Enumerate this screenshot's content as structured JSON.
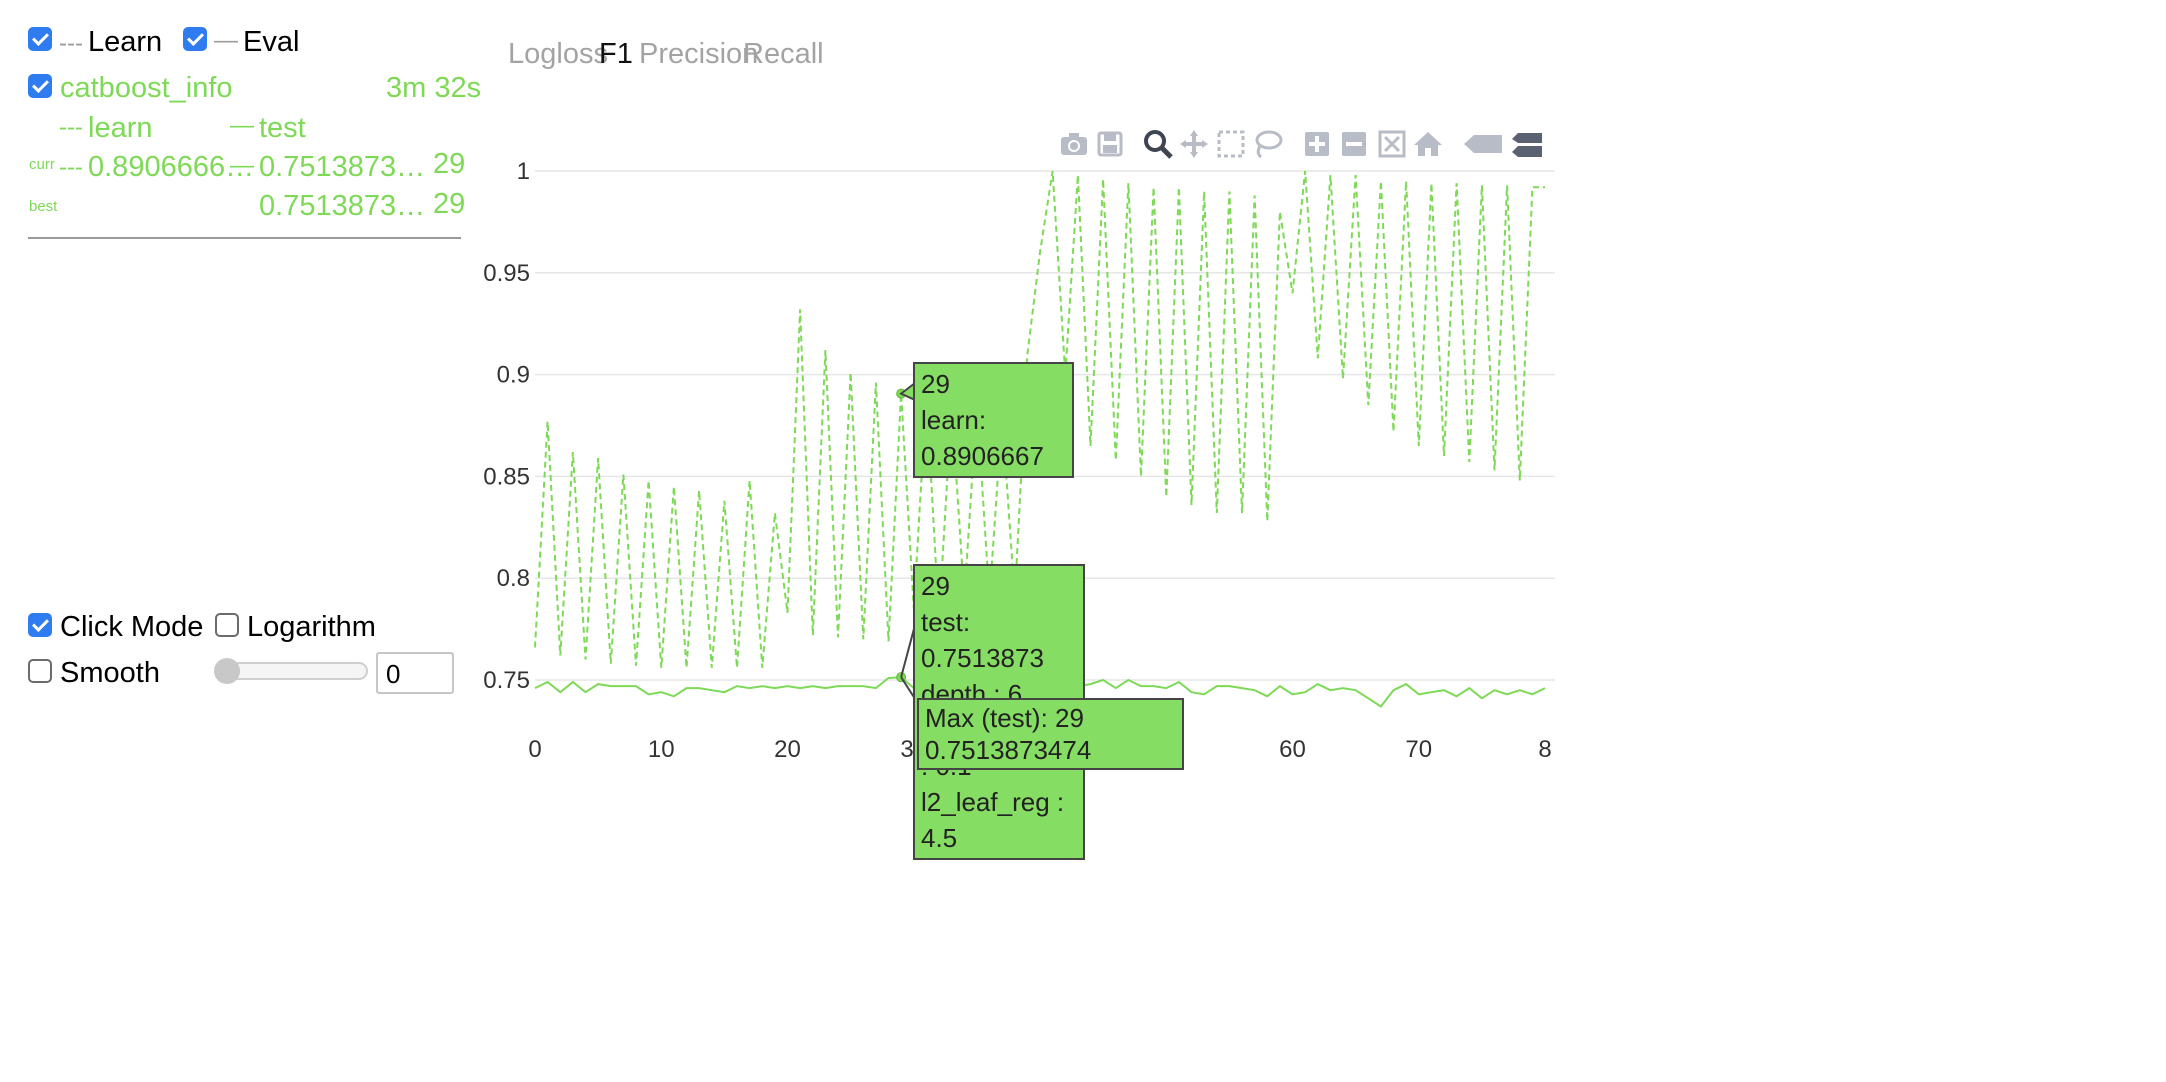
{
  "legend": {
    "learn": {
      "label": "Learn",
      "checked": true
    },
    "eval": {
      "label": "Eval",
      "checked": true
    }
  },
  "run": {
    "name": "catboost_info",
    "duration": "3m 32s",
    "col_learn": "learn",
    "col_test": "test",
    "curr_label": "curr",
    "curr_learn": "0.8906666…",
    "curr_test": "0.7513873…",
    "curr_iter": "29",
    "best_label": "best",
    "best_test": "0.7513873…",
    "best_iter": "29"
  },
  "metrics": [
    {
      "label": "Logloss",
      "active": false
    },
    {
      "label": "F1",
      "active": true
    },
    {
      "label": "Precision",
      "active": false
    },
    {
      "label": "Recall",
      "active": false
    }
  ],
  "controls": {
    "click_mode": {
      "label": "Click Mode",
      "checked": true
    },
    "logarithm": {
      "label": "Logarithm",
      "checked": false
    },
    "smooth": {
      "label": "Smooth",
      "checked": false
    },
    "smooth_value": "0"
  },
  "toolbar": [
    {
      "name": "camera-icon"
    },
    {
      "name": "save-icon"
    },
    {
      "name": "zoom-icon"
    },
    {
      "name": "pan-icon"
    },
    {
      "name": "box-select-icon"
    },
    {
      "name": "lasso-icon"
    },
    {
      "name": "zoom-in-icon"
    },
    {
      "name": "zoom-out-icon"
    },
    {
      "name": "autoscale-icon"
    },
    {
      "name": "home-icon"
    },
    {
      "name": "spike-lines-icon"
    },
    {
      "name": "compare-hover-icon"
    }
  ],
  "tooltips": {
    "learn": {
      "lines": [
        "29",
        "learn: 0.8906667"
      ]
    },
    "test": {
      "lines": [
        "29",
        "test: 0.7513873",
        "depth : 6",
        "learning_rate : 0.1",
        "l2_leaf_reg : 4.5"
      ]
    },
    "max": {
      "text": "Max (test): 29 0.7513873474"
    }
  },
  "colors": {
    "series": "#7ed957",
    "tooltip": "#86dd63",
    "checkbox": "#2f7bf0"
  },
  "chart_data": {
    "type": "line",
    "title": "",
    "xlabel": "",
    "ylabel": "",
    "xlim": [
      0,
      80
    ],
    "ylim": [
      0.735,
      1.0
    ],
    "x_ticks": [
      "0",
      "10",
      "20",
      "30",
      "40",
      "50",
      "60",
      "70",
      "8"
    ],
    "y_ticks": [
      "0.75",
      "0.8",
      "0.85",
      "0.9",
      "0.95",
      "1"
    ],
    "grid": true,
    "series": [
      {
        "name": "learn",
        "style": "dashed",
        "x": [
          0,
          1,
          2,
          3,
          4,
          5,
          6,
          7,
          8,
          9,
          10,
          11,
          12,
          13,
          14,
          15,
          16,
          17,
          18,
          19,
          20,
          21,
          22,
          23,
          24,
          25,
          26,
          27,
          28,
          29,
          30,
          31,
          32,
          33,
          34,
          35,
          36,
          37,
          38,
          39,
          40,
          41,
          42,
          43,
          44,
          45,
          46,
          47,
          48,
          49,
          50,
          51,
          52,
          53,
          54,
          55,
          56,
          57,
          58,
          59,
          60,
          61,
          62,
          63,
          64,
          65,
          66,
          67,
          68,
          69,
          70,
          71,
          72,
          73,
          74,
          75,
          76,
          77,
          78,
          79,
          80
        ],
        "values": [
          0.766,
          0.877,
          0.762,
          0.862,
          0.76,
          0.859,
          0.758,
          0.851,
          0.757,
          0.848,
          0.756,
          0.845,
          0.756,
          0.843,
          0.756,
          0.838,
          0.756,
          0.848,
          0.756,
          0.832,
          0.783,
          0.932,
          0.772,
          0.912,
          0.771,
          0.901,
          0.77,
          0.896,
          0.769,
          0.8906667,
          0.785,
          0.89,
          0.78,
          0.885,
          0.79,
          0.885,
          0.79,
          0.88,
          0.79,
          0.91,
          0.96,
          1.0,
          0.9,
          0.998,
          0.865,
          0.996,
          0.858,
          0.994,
          0.85,
          0.992,
          0.84,
          0.992,
          0.836,
          0.99,
          0.832,
          0.99,
          0.832,
          0.988,
          0.828,
          0.98,
          0.94,
          1.0,
          0.908,
          0.998,
          0.898,
          0.998,
          0.885,
          0.995,
          0.872,
          0.995,
          0.865,
          0.994,
          0.86,
          0.994,
          0.857,
          0.993,
          0.853,
          0.993,
          0.848,
          0.992,
          0.992
        ]
      },
      {
        "name": "test",
        "style": "solid",
        "x": [
          0,
          1,
          2,
          3,
          4,
          5,
          6,
          7,
          8,
          9,
          10,
          11,
          12,
          13,
          14,
          15,
          16,
          17,
          18,
          19,
          20,
          21,
          22,
          23,
          24,
          25,
          26,
          27,
          28,
          29,
          30,
          31,
          32,
          33,
          34,
          35,
          36,
          37,
          38,
          39,
          40,
          41,
          42,
          43,
          44,
          45,
          46,
          47,
          48,
          49,
          50,
          51,
          52,
          53,
          54,
          55,
          56,
          57,
          58,
          59,
          60,
          61,
          62,
          63,
          64,
          65,
          66,
          67,
          68,
          69,
          70,
          71,
          72,
          73,
          74,
          75,
          76,
          77,
          78,
          79,
          80
        ],
        "values": [
          0.746,
          0.749,
          0.744,
          0.749,
          0.744,
          0.748,
          0.747,
          0.747,
          0.747,
          0.743,
          0.744,
          0.742,
          0.746,
          0.746,
          0.745,
          0.744,
          0.747,
          0.746,
          0.747,
          0.746,
          0.747,
          0.746,
          0.747,
          0.746,
          0.747,
          0.747,
          0.747,
          0.746,
          0.751,
          0.7513873,
          0.746,
          0.749,
          0.745,
          0.749,
          0.746,
          0.748,
          0.746,
          0.749,
          0.746,
          0.75,
          0.747,
          0.748,
          0.749,
          0.747,
          0.748,
          0.75,
          0.746,
          0.75,
          0.747,
          0.747,
          0.746,
          0.749,
          0.744,
          0.743,
          0.747,
          0.747,
          0.746,
          0.745,
          0.742,
          0.747,
          0.743,
          0.744,
          0.748,
          0.745,
          0.746,
          0.745,
          0.741,
          0.737,
          0.745,
          0.748,
          0.743,
          0.744,
          0.745,
          0.742,
          0.746,
          0.741,
          0.745,
          0.743,
          0.745,
          0.743,
          0.746
        ]
      }
    ],
    "annotations": [
      {
        "series": "learn",
        "x": 29,
        "y": 0.8906667
      },
      {
        "series": "test",
        "x": 29,
        "y": 0.7513873
      }
    ]
  }
}
